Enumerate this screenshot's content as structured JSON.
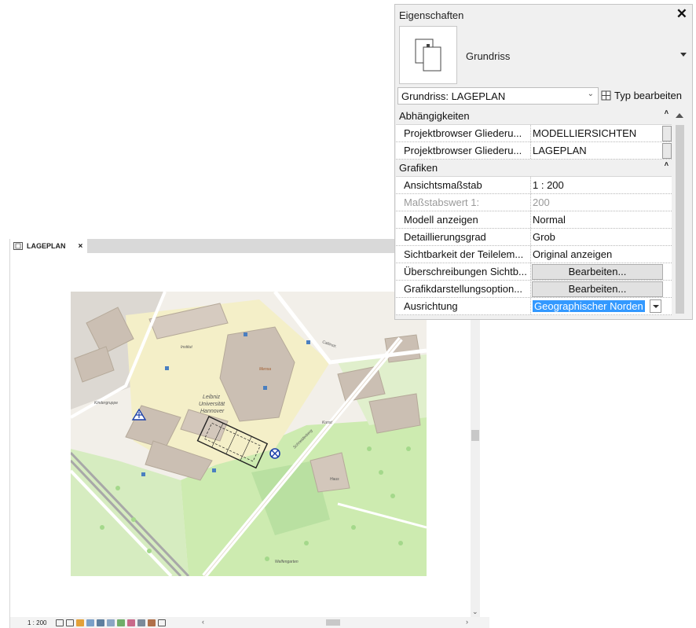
{
  "view": {
    "tab_label": "LAGEPLAN",
    "tab_close": "×",
    "status": {
      "scale": "1 : 200"
    },
    "map": {
      "labels": {
        "leibniz": "Leibniz",
        "universitat": "Universität",
        "hannover": "Hannover",
        "krankenhaus": "Kindergruppe",
        "welfengarten": "Welfengarten",
        "schneiderberg": "Schneiderberg",
        "kunst": "Kunst",
        "haus": "Haus",
        "institut": "Institut",
        "mensa": "Mensa",
        "callinstr": "Callinstr."
      }
    }
  },
  "properties": {
    "title": "Eigenschaften",
    "close": "✕",
    "type_name": "Grundriss",
    "instance": "Grundriss: LAGEPLAN",
    "edit_type": "Typ bearbeiten",
    "categories": [
      {
        "name": "Abhängigkeiten",
        "rows": [
          {
            "key": "Projektbrowser Gliederu...",
            "value": "MODELLIERSICHTEN",
            "kind": "chip"
          },
          {
            "key": "Projektbrowser Gliederu...",
            "value": "LAGEPLAN",
            "kind": "chip"
          }
        ]
      },
      {
        "name": "Grafiken",
        "rows": [
          {
            "key": "Ansichtsmaßstab",
            "value": "1 : 200",
            "kind": "text"
          },
          {
            "key": "Maßstabswert 1:",
            "value": "200",
            "kind": "disabled"
          },
          {
            "key": "Modell anzeigen",
            "value": "Normal",
            "kind": "text"
          },
          {
            "key": "Detaillierungsgrad",
            "value": "Grob",
            "kind": "text"
          },
          {
            "key": "Sichtbarkeit der Teilelem...",
            "value": "Original anzeigen",
            "kind": "text"
          },
          {
            "key": "Überschreibungen Sichtb...",
            "value": "Bearbeiten...",
            "kind": "button"
          },
          {
            "key": "Grafikdarstellungsoption...",
            "value": "Bearbeiten...",
            "kind": "button"
          },
          {
            "key": "Ausrichtung",
            "value": "Geographischer Norden",
            "kind": "select"
          }
        ]
      }
    ]
  }
}
